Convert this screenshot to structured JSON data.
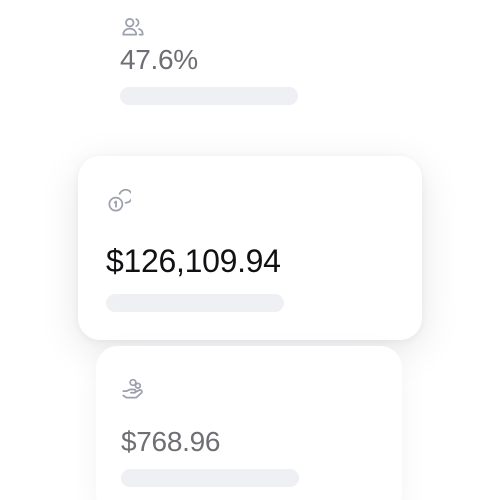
{
  "stats": [
    {
      "icon": "users-icon",
      "value": "47.6%"
    },
    {
      "icon": "coins-icon",
      "value": "$126,109.94"
    },
    {
      "icon": "hand-coins-icon",
      "value": "$768.96"
    }
  ],
  "colors": {
    "icon_stroke": "#9aa0ac",
    "value_focused": "#111114",
    "value_faded": "#6e6e74",
    "bar_placeholder": "#eef0f4"
  }
}
